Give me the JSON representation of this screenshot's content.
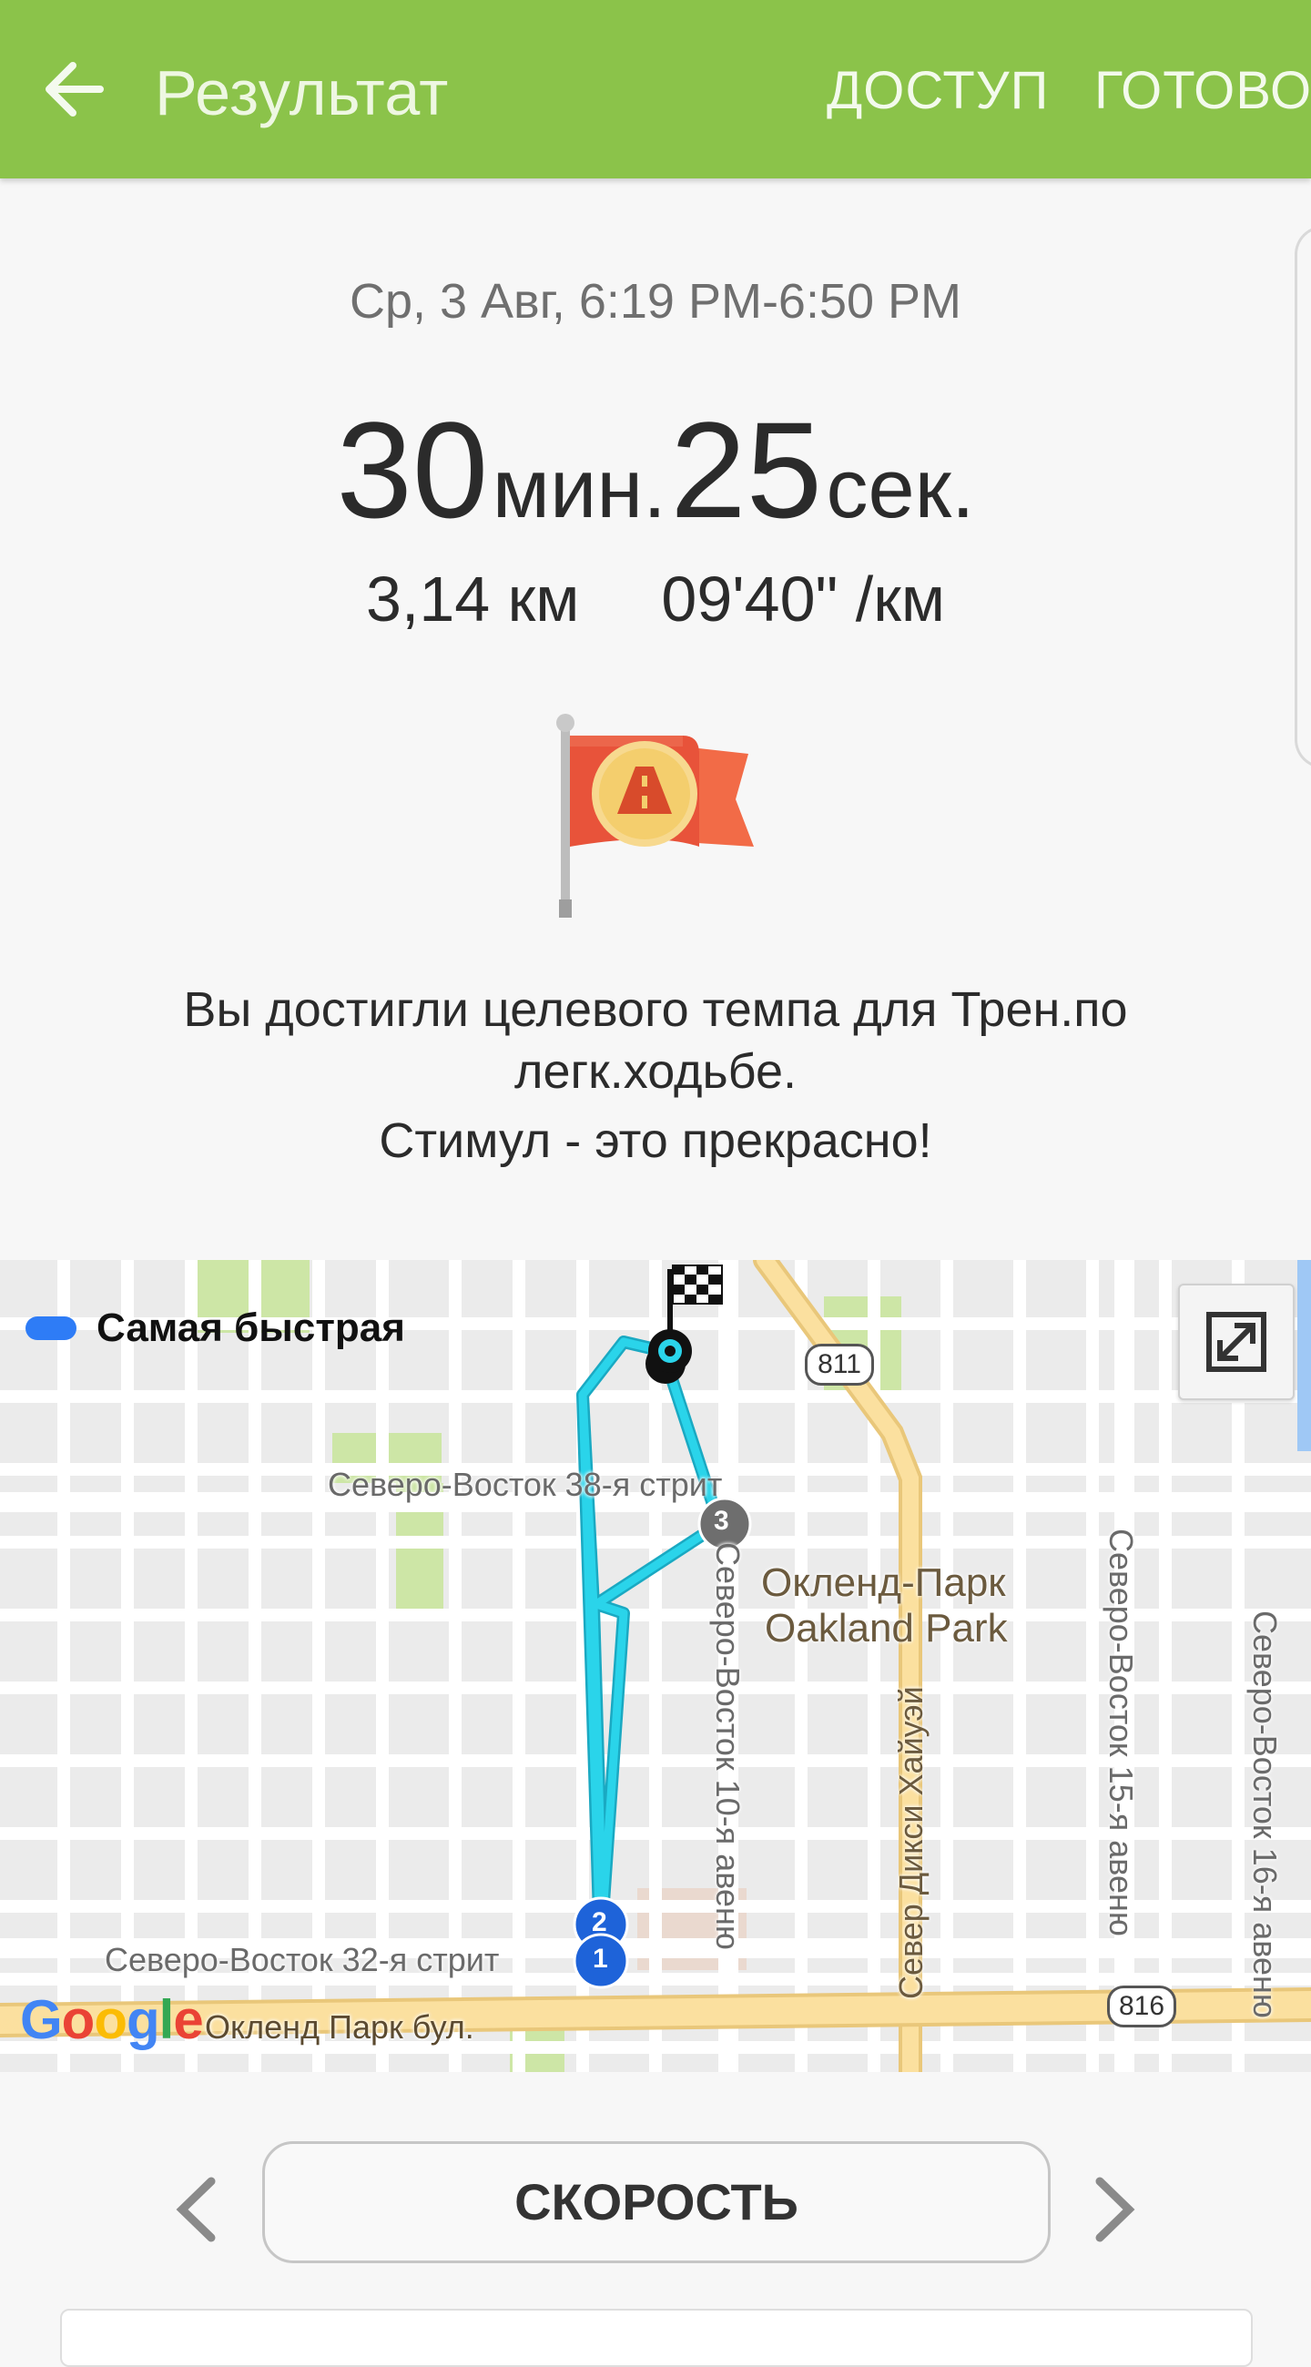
{
  "header": {
    "title": "Результат",
    "share_label": "ДОСТУП",
    "done_label": "ГОТОВО",
    "back_icon": "arrow-left-icon",
    "background": "#8bc34a"
  },
  "summary": {
    "date_range": "Ср, 3 Авг, 6:19 PM-6:50 PM",
    "minutes": "30",
    "minutes_unit": "мин.",
    "seconds": "25",
    "seconds_unit": "сек.",
    "distance": "3,14 км",
    "pace": "09'40\" /км",
    "badge_icon": "pace-target-flag-icon",
    "message_line1": "Вы достигли целевого темпа для Трен.по легк.ходьбе.",
    "message_line2": "Стимул - это прекрасно!"
  },
  "map": {
    "legend_label": "Самая быстрая",
    "legend_color": "#2e7cf6",
    "route_color": "#2ad4ea",
    "expand_icon": "expand-icon",
    "labels": {
      "street_38": "Северо-Восток 38-я стрит",
      "street_32": "Северо-Восток 32-я стрит",
      "avenue_10": "Северо-Восток 10-я авеню",
      "avenue_15": "Северо-Восток 15-я авеню",
      "avenue_16": "Северо-Восток 16-я авеню",
      "dixie": "Север Дикси Хайуэй",
      "blvd": "Окленд Парк бул.",
      "area_ru": "Окленд-Парк",
      "area_en": "Oakland Park",
      "route_811": "811",
      "route_816": "816"
    },
    "markers": {
      "m1": "1",
      "m2": "2",
      "m3": "3"
    },
    "google": [
      "G",
      "o",
      "o",
      "g",
      "l",
      "e"
    ]
  },
  "footer": {
    "mode_label": "СКОРОСТЬ",
    "prev_icon": "chevron-left-icon",
    "next_icon": "chevron-right-icon"
  }
}
